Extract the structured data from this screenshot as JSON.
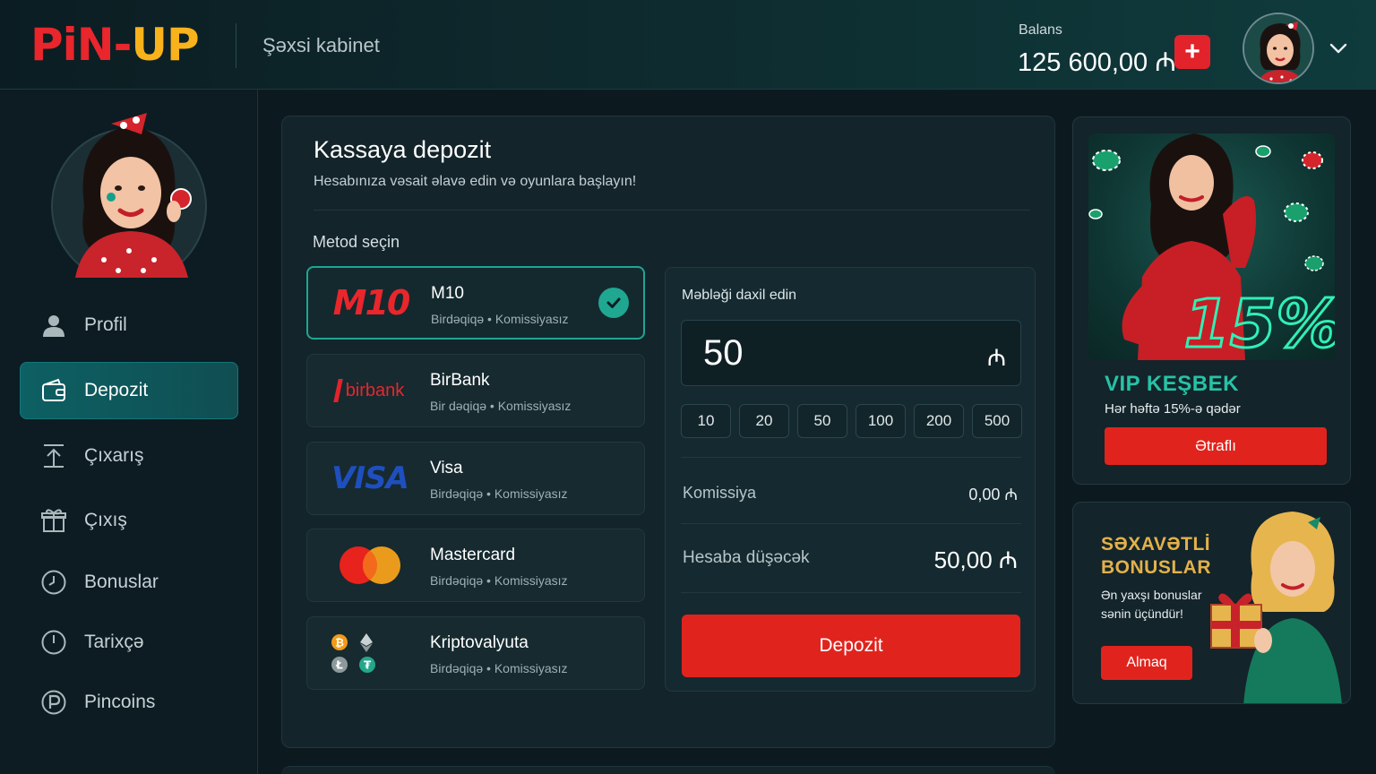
{
  "header": {
    "logo": {
      "pin": "PiN",
      "dash": "-",
      "up": "UP"
    },
    "title": "Şəxsi kabinet",
    "balance_label": "Balans",
    "balance_value": "125 600,00 ₼",
    "add_icon": "plus-icon",
    "avatar_icon": "pinup-girl-avatar",
    "chevron_icon": "chevron-down-icon"
  },
  "sidebar": {
    "items": [
      {
        "label": "Profil",
        "icon": "user-icon",
        "active": false
      },
      {
        "label": "Depozit",
        "icon": "wallet-icon",
        "active": true
      },
      {
        "label": "Çıxarış",
        "icon": "upload-icon",
        "active": false
      },
      {
        "label": "Çıxış",
        "icon": "gift-icon",
        "active": false
      },
      {
        "label": "Bonuslar",
        "icon": "clock-icon",
        "active": false
      },
      {
        "label": "Tarixçə",
        "icon": "history-icon",
        "active": false
      },
      {
        "label": "Pincoins",
        "icon": "coin-p-icon",
        "active": false
      }
    ]
  },
  "main": {
    "title": "Kassaya depozit",
    "subtitle": "Hesabınıza vəsait əlavə edin və oyunlara başlayın!",
    "method_label": "Metod seçin",
    "methods": [
      {
        "name": "M10",
        "sub": "Birdəqiqə • Komissiyasız",
        "logo": "M10",
        "selected": true
      },
      {
        "name": "BirBank",
        "sub": "Bir dəqiqə • Komissiyasız",
        "logo": "birbank",
        "selected": false
      },
      {
        "name": "Visa",
        "sub": "Birdəqiqə • Komissiyasız",
        "logo": "VISA",
        "selected": false
      },
      {
        "name": "Mastercard",
        "sub": "Birdəqiqə • Komissiyasız",
        "logo": "mastercard-icon",
        "selected": false
      },
      {
        "name": "Kriptovalyuta",
        "sub": "Birdəqiqə • Komissiyasız",
        "logo": "crypto-icons",
        "selected": false
      }
    ],
    "amount": {
      "label": "Məbləği daxil edin",
      "value": "50",
      "currency": "₼",
      "presets": [
        "10",
        "20",
        "50",
        "100",
        "200",
        "500"
      ],
      "commission_label": "Komissiya",
      "commission_value": "0,00 ₼",
      "credit_label": "Hesaba düşəcək",
      "credit_value": "50,00 ₼",
      "button": "Depozit"
    }
  },
  "promos": [
    {
      "badge": "15%",
      "title": "VIP KEŞBEK",
      "subtitle": "Hər həftə 15%-ə qədər",
      "button": "Ətraflı"
    },
    {
      "title_line1": "SƏXAVƏTLİ",
      "title_line2": "BONUSLAR",
      "subtitle": "Ən yaxşı bonuslar sənin üçündür!",
      "button": "Almaq"
    }
  ],
  "colors": {
    "accent_red": "#e0241d",
    "accent_teal": "#1fa792",
    "logo_red": "#e8262c",
    "logo_yellow": "#f7b21c",
    "promo_gold": "#e3b14a"
  }
}
